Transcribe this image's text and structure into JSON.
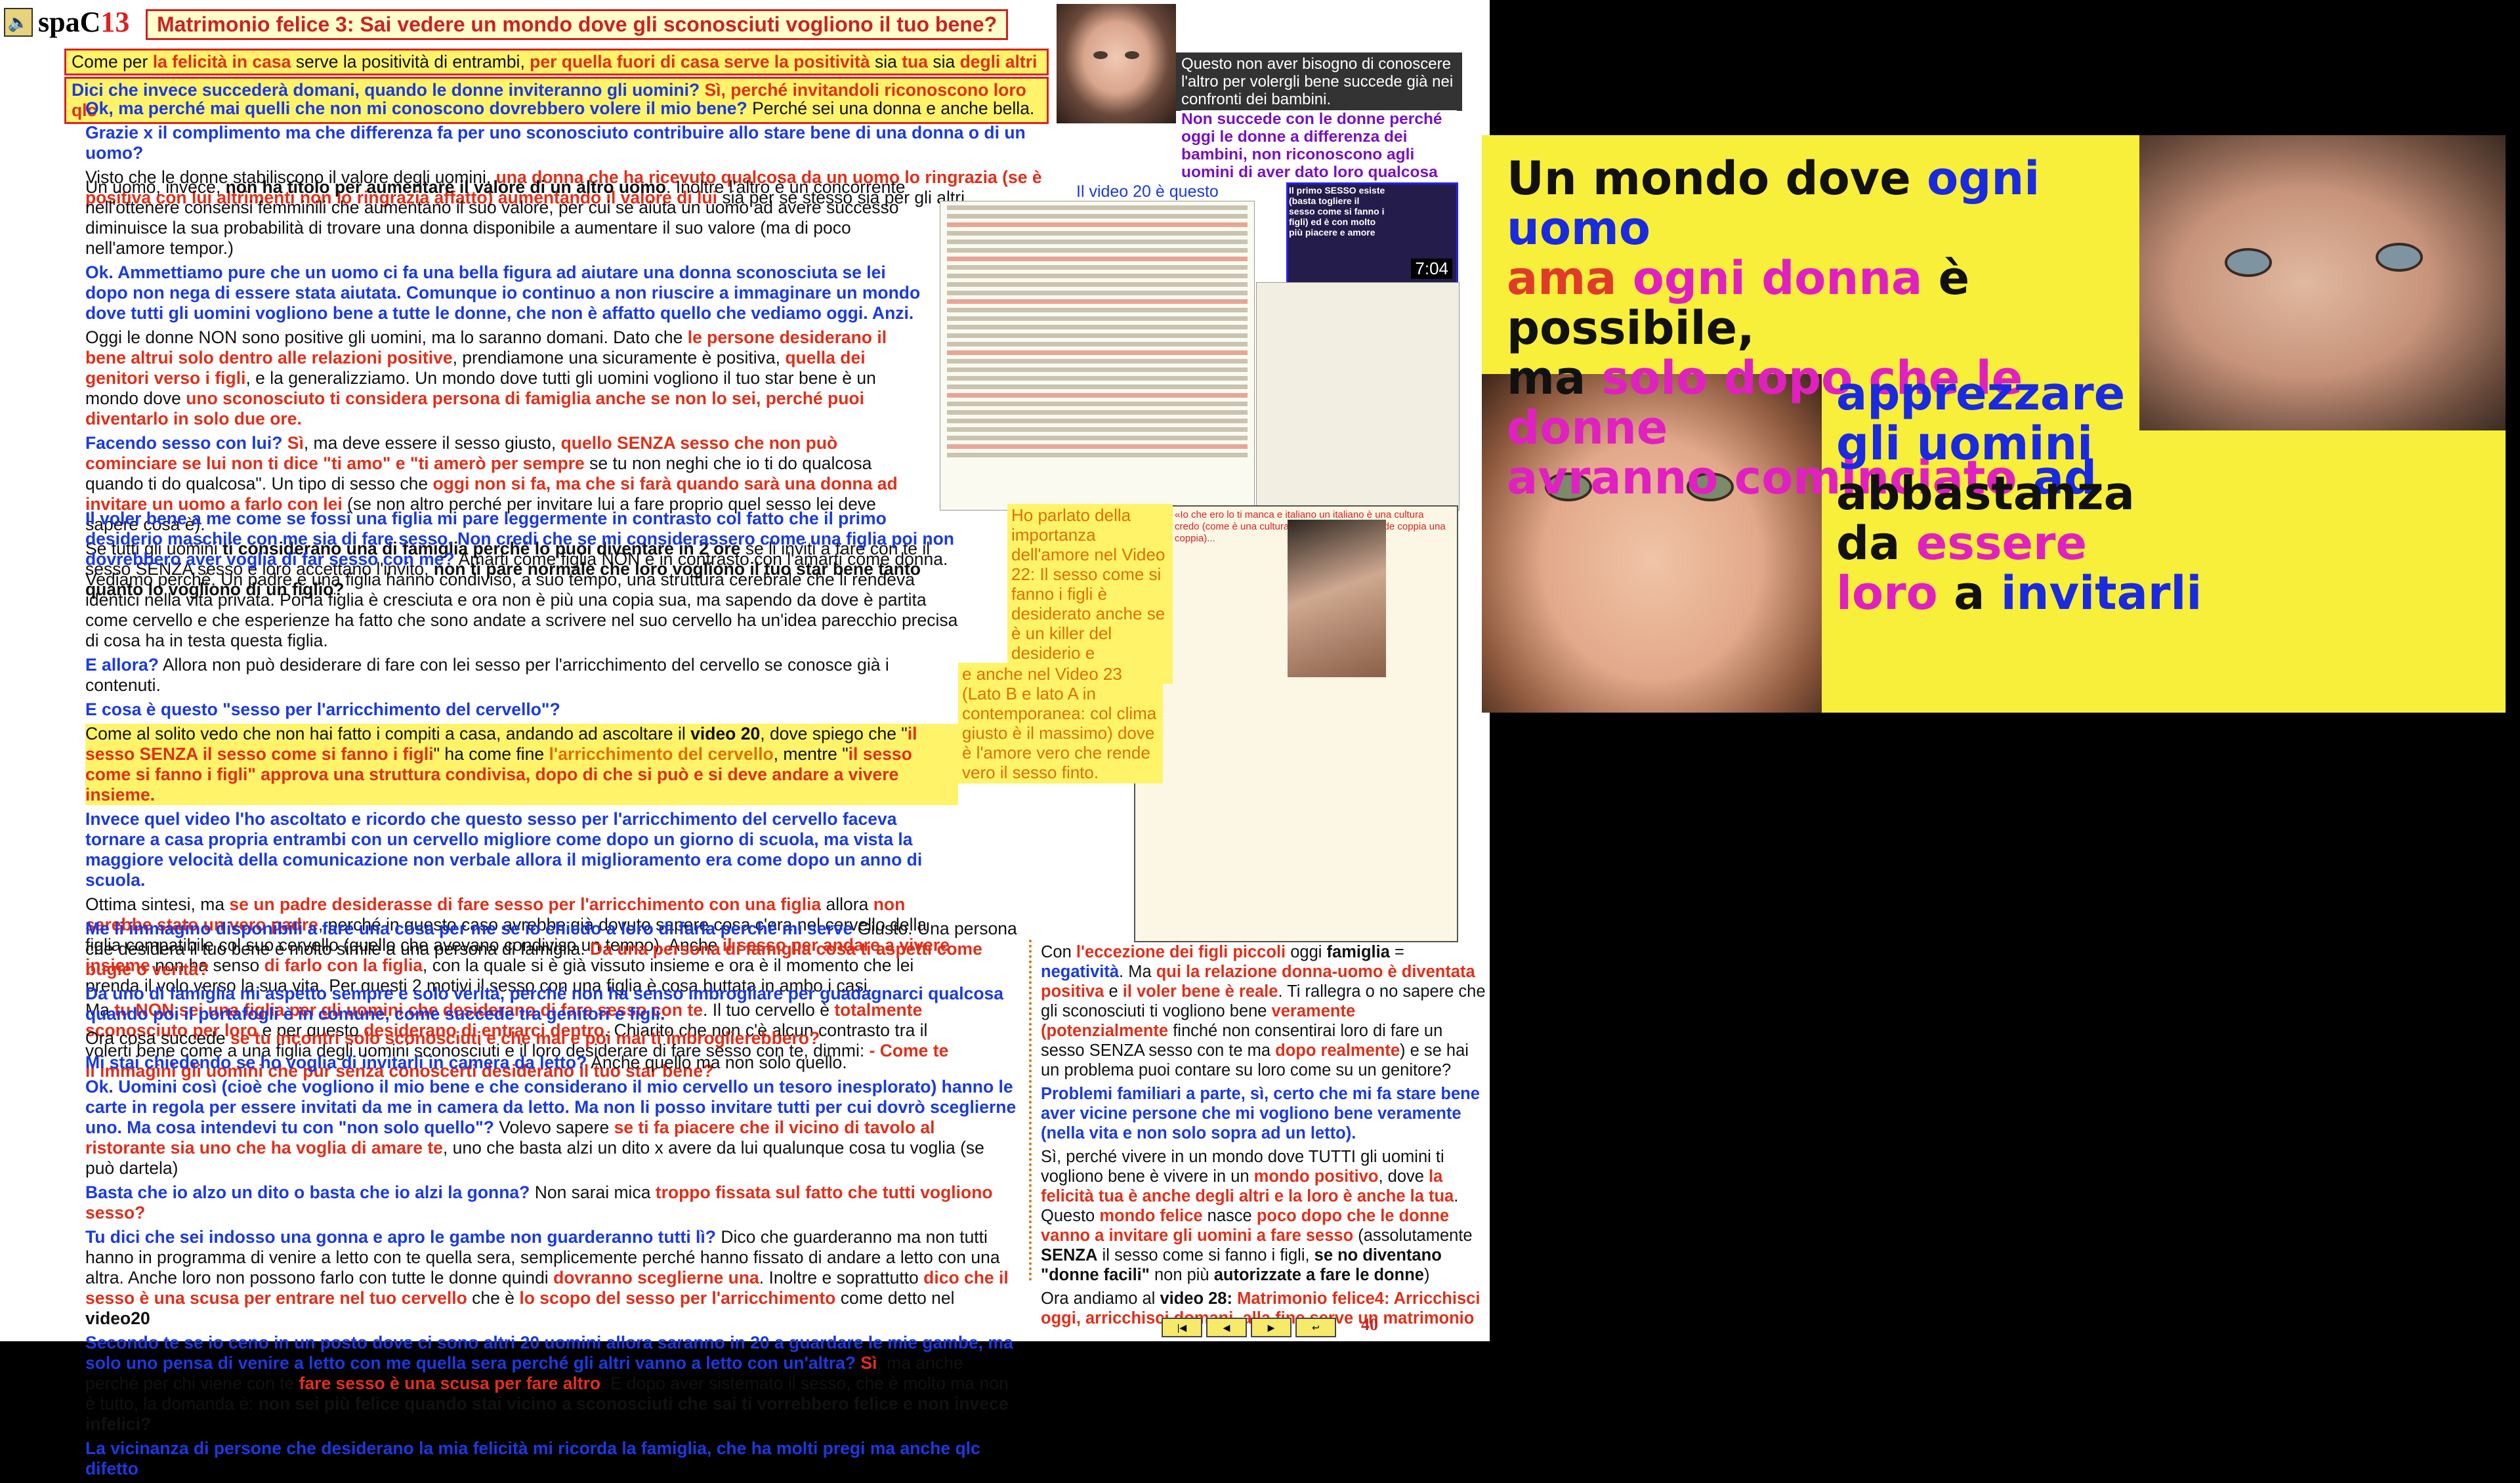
{
  "header": {
    "speaker_icon": "speaker-icon",
    "brand": "spaC",
    "number": "13",
    "title": "Matrimonio felice 3: Sai vedere un mondo dove gli sconosciuti vogliono il tuo bene?"
  },
  "intro": {
    "l1a": "Come per ",
    "l1b": "la felicità in casa",
    "l1c": " serve la positività di entrambi, ",
    "l1d": "per quella fuori di casa serve la ",
    "l1e": "positività",
    "l1f": " sia ",
    "l1g": "tua",
    "l1h": " sia ",
    "l1i": "degli altri",
    "l2a": "Dici che invece succederà domani, quando le donne inviteranno gli uomini? ",
    "l2b": "Sì, perché invitandoli riconoscono loro qlc"
  },
  "video_small": {
    "caption": "Questo non aver bisogno di conoscere l'altro per volergli bene succede già nei confronti dei bambini.",
    "note": "Non succede con le donne perché oggi le donne a differenza dei bambini, non riconoscono agli uomini di aver dato loro qualcosa",
    "video20": "Il video 20 è questo",
    "duration": "7:04",
    "thumb_text": "Il primo SESSO esiste (basta togliere il sesso come si fanno i figli) ed è con molto più piacere e amore"
  },
  "paragraphs": {
    "p1": "Ok, ma perché mai quelli che non mi conoscono dovrebbero volere il mio bene?",
    "p1b": " Perché sei una donna e anche bella.",
    "p2": "Grazie x il complimento ma che differenza fa per uno sconosciuto contribuire allo stare bene di una donna o di un uomo?",
    "p3a": "Visto che le donne stabiliscono il valore degli uomini, ",
    "p3b": "una donna che ha ricevuto qualcosa da un uomo lo ringrazia",
    "p3c": " (se è positiva con lui altrimenti non lo ringrazia affatto) ",
    "p3d": "aumentando il valore di lui",
    "p3e": " sia per se stesso sia per gli altri.",
    "p4a": "Un uomo, invece, ",
    "p4b": "non ha titolo per aumentare il valore di un altro uomo",
    "p4c": ". Inoltre l'altro è un concorrente nell'ottenere consensi femminili che aumentano il suo valore, per cui se aiuta un uomo ad avere successo diminuisce la sua probabilità di trovare una donna disponibile a aumentare il suo valore (ma di poco nell'amore tempor.)",
    "p5": "Ok. Ammettiamo pure che un uomo ci fa una bella figura ad aiutare una donna sconosciuta se lei dopo non nega di essere stata aiutata. Comunque io continuo a non riuscire a immaginare un mondo dove tutti gli uomini vogliono bene a tutte le donne, che non è affatto quello che vediamo oggi. Anzi.",
    "p6a": "Oggi le donne NON sono positive gli uomini, ma lo saranno domani. Dato che ",
    "p6b": "le persone desiderano il bene altrui solo dentro alle relazioni positive",
    "p6c": ", prendiamone una sicuramente è positiva, ",
    "p6d": "quella dei genitori verso i figli",
    "p6e": ", e la generalizziamo. Un mondo dove tutti gli uomini vogliono il tuo star bene è un mondo dove ",
    "p6f": "uno sconosciuto ti considera persona di famiglia anche se non lo sei, perché puoi diventarlo in solo due ore.",
    "p7a": "Facendo sesso con lui? ",
    "p7b": "Sì",
    "p7c": ", ma deve essere il sesso giusto, ",
    "p7d": "quello SENZA sesso che non può cominciare se lui non ti dice \"ti amo\" e \"ti amerò per sempre",
    "p7e": " se tu non neghi che io ti do qualcosa quando ti do qualcosa\". Un tipo di sesso che ",
    "p7f": "oggi non si fa, ma che si farà quando sarà una donna ad invitare un uomo a farlo con lei",
    "p7g": " (se non altro perché per invitare lui a fare proprio quel sesso lei deve sapere cosa è).",
    "p8a": "Se tutti gli uomini ",
    "p8b": "ti considerano una di famiglia perché lo puoi diventare in 2 ore",
    "p8c": " se li inviti a fare con te il sesso SENZA sesso e loro accettano l'invito, ",
    "p8d": "non ti pare normale che loro vogliono il tuo star bene tanto quanto lo vogliono di un figlio?",
    "p9": "Il voler bene a me come se fossi una figlia mi pare leggermente in contrasto col fatto che il primo desiderio maschile con me sia di fare sesso. Non credi che se mi considerassero come una figlia poi non dovrebbero aver voglia di far sesso con me?",
    "p9b": " Amarti come figlia NON è in contrasto con l'amarti come donna. Vediamo perché. Un padre e una figlia hanno condiviso, a suo tempo, una struttura cerebrale che li rendeva identici nella vita privata. Poi la figlia è cresciuta e ora non è più una copia sua, ma sapendo da dove è partita come cervello e che esperienze ha fatto che sono andate a scrivere nel suo cervello ha un'idea parecchio precisa di cosa ha in testa questa figlia.",
    "p10a": "E allora?",
    "p10b": " Allora non può desiderare di fare con lei sesso per l'arricchimento del cervello se conosce già i contenuti.",
    "p11": "E cosa è questo \"sesso per l'arricchimento del cervello\"?",
    "p12a": "Come al solito vedo che non hai fatto i compiti a casa, andando ad ascoltare il ",
    "p12b": "video 20",
    "p12c": ", dove spiego che \"",
    "p12d": "il sesso SENZA il sesso come si fanno i figli",
    "p12e": "\" ha come fine ",
    "p12f": "l'arricchimento del cervello",
    "p12g": ", mentre \"",
    "p12h": "il sesso come si fanno i figli",
    "p12i": "\" approva una struttura condivisa, dopo di che si può e si deve andare a vivere insieme.",
    "p13": "Invece quel video l'ho ascoltato e ricordo che questo sesso per l'arricchimento del cervello faceva tornare a casa propria entrambi con un cervello migliore come dopo un giorno di scuola, ma vista la maggiore velocità della comunicazione non verbale allora il miglioramento era come dopo un anno di scuola.",
    "p14a": "Ottima sintesi, ma ",
    "p14b": "se un padre desiderasse di fare sesso per l'arricchimento con una figlia",
    "p14c": " allora ",
    "p14d": "non sarebbe stato un vero padre",
    "p14e": ", perché in questo caso avrebbe già dovuto sapere cosa c'era nel cervello della figlia compatibile col suo cervello (quello che avevano condiviso un tempo). Anche ",
    "p14f": "il sesso per andare a vivere insieme",
    "p14g": " non ha senso ",
    "p14h": "di farlo con la figlia",
    "p14i": ", con la quale si è già vissuto insieme e ora è il momento che lei prenda il volo verso la sua vita. Per questi 2 motivi il sesso con una figlia è cosa buttata in ambo i casi.",
    "p15a": "Ma ",
    "p15b": "tu NON sei una figlia per gli uomini che desiderano di fare sesso con te",
    "p15c": ". Il tuo cervello è ",
    "p15d": "totalmente sconosciuto per loro",
    "p15e": " e per questo ",
    "p15f": "desiderano di entrarci dentro",
    "p15g": ". Chiarito che non c'è alcun contrasto tra il volerti bene come a una figlia degli uomini sconosciuti e il loro desiderare di fare sesso con te, dimmi: ",
    "p15h": "- Come te li immagini gli uomini che pur senza conoscerti desiderano il tuo star bene?",
    "p16": "Me li immagino disponibili a fare una cosa per me se io chiedo a loro di farla perché mi serve",
    "p16b": " Giusto. Una persona che desidera il tuo bene è molto simile a una persona di famiglia. ",
    "p16c": "Da una persona di famiglia cosa ti aspetti come bugie o verità?",
    "p17": "Da uno di famiglia mi aspetto sempre e solo verità, perché non ha senso imbrogliare per guadagnarci qualcosa quando poi il portafogli è in comune, come succede tra genitori e figli.",
    "p18a": "Ora cosa succede ",
    "p18b": "se tu incontri solo sconosciuti e che mai e poi mai ti imbroglierebbero?",
    "p19": "Mi stai chiedendo se ho voglia di invitarli in camera da letto?",
    "p19b": " Anche quello ma non solo quello.",
    "p20": "Ok. Uomini così (cioè che vogliono il mio bene e che considerano il mio cervello un tesoro inesplorato) hanno le carte in regola per essere invitati da me in camera da letto. Ma non li posso invitare tutti per cui dovrò sceglierne uno. Ma cosa intendevi tu con \"non solo quello\"?",
    "p20b": " Volevo sapere ",
    "p20c": "se ti fa piacere che il vicino di tavolo al ristorante sia uno che ha voglia di amare te",
    "p20d": ", uno che basta alzi un dito x avere da lui qualunque cosa tu voglia (se può dartela)",
    "p21a": "Basta che io alzo un dito o basta che io alzi la gonna?",
    "p21b": " Non sarai mica ",
    "p21c": "troppo fissata sul fatto che tutti vogliono sesso?",
    "p22a": "Tu dici che sei indosso una gonna e apro le gambe non guarderanno tutti lì?",
    "p22b": " Dico che guarderanno ma non tutti hanno in programma di venire a letto con te quella sera, semplicemente perché hanno fissato di andare a letto con una altra. Anche loro non possono farlo con tutte le donne quindi ",
    "p22c": "dovranno sceglierne una",
    "p22d": ". Inoltre e soprattutto ",
    "p22e": "dico che il sesso è una scusa per entrare nel tuo cervello",
    "p22f": " che è ",
    "p22g": "lo scopo del sesso per l'arricchimento",
    "p22h": " come detto nel ",
    "p22i": "video20",
    "p23": "Secondo te se io ceno in un posto dove ci sono altri 20 uomini allora saranno in 20 a guardare le mie gambe, ma solo uno pensa di venire a letto con me quella sera perché gli altri vanno a letto con un'altra?",
    "p23b": " Sì",
    "p23c": ", ma anche perché per chi viene con te ",
    "p23d": "fare sesso è una scusa per fare altro",
    "p23e": ". E dopo aver sistemato il sesso, che è molto ma non è tutto, la domanda è: ",
    "p23f": "non sei più felice quando stai vicino a sconosciuti che sai ti vorrebbero felice e non invece infelici?",
    "p24": "La vicinanza di persone che desiderano la mia felicità mi ricorda la famiglia, che ha molti pregi ma anche qlc difetto"
  },
  "side_notes": {
    "note1": "Ho parlato della importanza dell'amore nel Video 22: Il sesso come si fanno i figli è desiderato anche se è un killer del desiderio e dell'amore",
    "note2": "e anche nel Video 23 (Lato B e lato A in contemporanea: col clima giusto è il massimo) dove è l'amore vero che rende vero il sesso finto.",
    "lower_doc_text": "«Io che ero lo ti manca e italiano un italiano è una cultura credo (come è una cultura condivisa ciò che rende coppia una coppia)..."
  },
  "right_col": {
    "r1a": "Con ",
    "r1b": "l'eccezione dei figli piccoli",
    "r1c": " oggi ",
    "r1d": "famiglia",
    "r1e": " = ",
    "r1f": "negatività",
    "r1g": ". Ma ",
    "r1h": "qui la relazione donna-uomo è diventata positiva",
    "r1i": " e ",
    "r1j": "il voler bene è reale",
    "r1k": ". Ti rallegra o no sapere che gli sconosciuti ti vogliono bene ",
    "r1l": "veramente (potenzialmente",
    "r1m": " finché non consentirai loro di fare un sesso SENZA sesso con te ma ",
    "r1n": "dopo realmente",
    "r1o": ") e se hai un problema puoi contare su loro come su un genitore?",
    "r2": "Problemi familiari a parte, sì, certo che mi fa stare bene aver vicine persone che mi vogliono bene veramente (nella vita e non solo sopra ad un letto).",
    "r3a": "Sì, perché vivere in un mondo dove TUTTI gli uomini ti vogliono bene è vivere in un ",
    "r3b": "mondo positivo",
    "r3c": ", dove ",
    "r3d": "la felicità tua è anche degli altri e la loro è anche la tua",
    "r3e": ". Questo ",
    "r3f": "mondo felice",
    "r3g": " nasce ",
    "r3h": "poco dopo che le donne vanno a invitare gli uomini a fare sesso",
    "r3i": " (assolutamente ",
    "r3j": "SENZA",
    "r3k": " il sesso come si fanno i figli, ",
    "r3l": "se no diventano \"donne facili\"",
    "r3m": " non più ",
    "r3n": "autorizzate a fare le donne",
    "r3o": ")",
    "r4a": "Ora andiamo al ",
    "r4b": "video 28: ",
    "r4c": "Matrimonio felice4: ",
    "r4d": "Arricchisci oggi, arricchisci domani, alla fine serve un matrimonio"
  },
  "big_slide": {
    "t1": "Un mondo dove ",
    "t2": "ogni uomo",
    "t3": "ama ",
    "t4": "ogni donna",
    "t5": " è possibile,",
    "t6": "ma ",
    "t7": "solo dopo che le donne",
    "t8": "avranno cominciato",
    "t9": " ad",
    "t10": "apprezzare",
    "t11": "gli uomini",
    "t12": "abbastanza",
    "t13": "da ",
    "t14": "essere",
    "t15": "loro",
    "t16": " a ",
    "t17": "invitarli"
  },
  "nav": {
    "first_icon": "first-page-icon",
    "prev_icon": "prev-page-icon",
    "next_icon": "next-page-icon",
    "home_icon": "home-icon",
    "page": "40"
  },
  "colors": {
    "accent_red": "#e0301a",
    "accent_blue": "#1a3ae0",
    "accent_magenta": "#c020c0",
    "accent_orange": "#e07000",
    "highlight": "#fff36a"
  }
}
